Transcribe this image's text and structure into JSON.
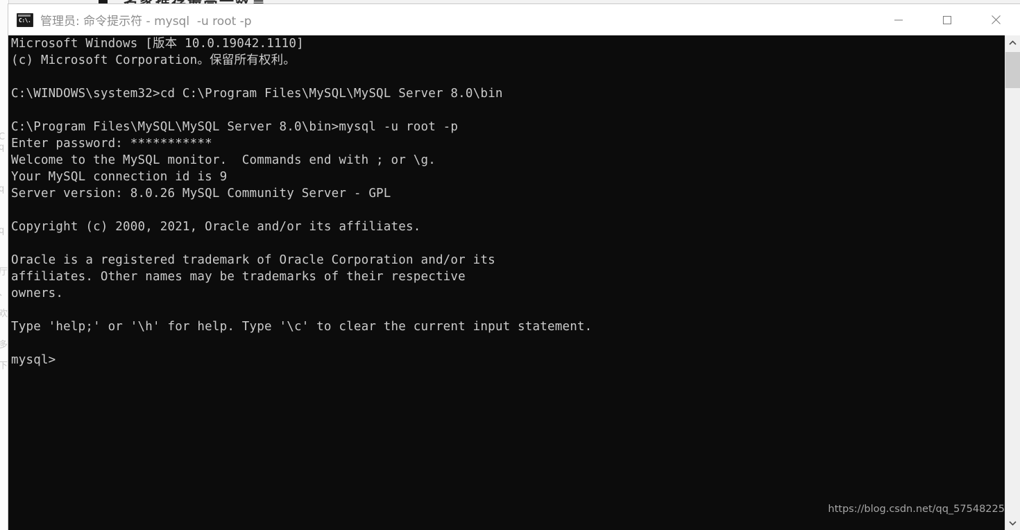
{
  "window": {
    "title": "管理员: 命令提示符 - mysql  -u root -p",
    "icon_name": "cmd-icon",
    "icon_prompt": "C:\\.",
    "minimize_label": "最小化",
    "maximize_label": "最大化",
    "close_label": "关闭",
    "title_bar_color": "#ffffff",
    "title_text_color": "#8d8d8d",
    "console_bg_color": "#0c0c0c",
    "console_text_color": "#cccccc"
  },
  "console": {
    "lines": [
      "Microsoft Windows [版本 10.0.19042.1110]",
      "(c) Microsoft Corporation。保留所有权利。",
      "",
      "C:\\WINDOWS\\system32>cd C:\\Program Files\\MySQL\\MySQL Server 8.0\\bin",
      "",
      "C:\\Program Files\\MySQL\\MySQL Server 8.0\\bin>mysql -u root -p",
      "Enter password: ***********",
      "Welcome to the MySQL monitor.  Commands end with ; or \\g.",
      "Your MySQL connection id is 9",
      "Server version: 8.0.26 MySQL Community Server - GPL",
      "",
      "Copyright (c) 2000, 2021, Oracle and/or its affiliates.",
      "",
      "Oracle is a registered trademark of Oracle Corporation and/or its",
      "affiliates. Other names may be trademarks of their respective",
      "owners.",
      "",
      "Type 'help;' or '\\h' for help. Type '\\c' to clear the current input statement.",
      "",
      "mysql>"
    ],
    "prompt": "mysql>",
    "password_mask": "***********",
    "command_1": "cd C:\\Program Files\\MySQL\\MySQL Server 8.0\\bin",
    "command_2": "mysql -u root -p",
    "server_version": "8.0.26 MySQL Community Server - GPL",
    "connection_id": "9",
    "windows_version": "10.0.19042.1110"
  },
  "watermark": {
    "text": "https://blog.csdn.net/qq_57548225"
  },
  "scrollbar": {
    "up_arrow_name": "scroll-up-arrow",
    "down_arrow_name": "scroll-down-arrow"
  },
  "background": {
    "top_text": "名家推荐最高一数言",
    "left_text": "C\nq\n卿\nq\n厅\n、\n欢\nq\n多\n下"
  }
}
